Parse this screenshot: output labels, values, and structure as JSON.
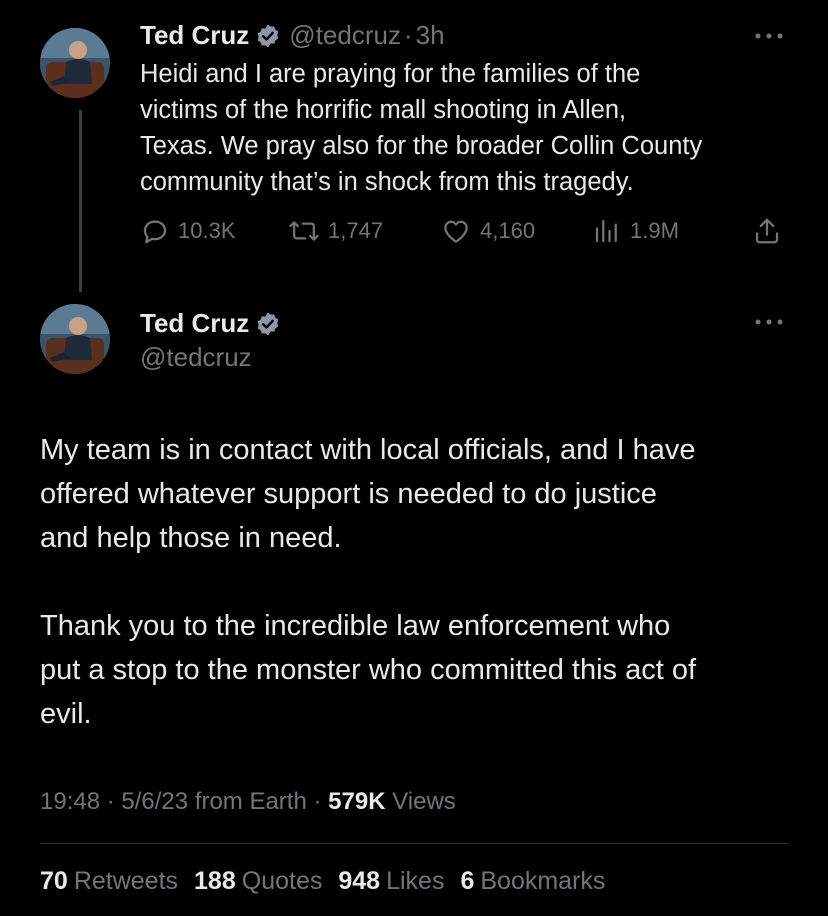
{
  "tweet1": {
    "author_name": "Ted Cruz",
    "handle": "@tedcruz",
    "separator": "·",
    "time": "3h",
    "text_lines": [
      "Heidi and I are praying for the families of the",
      "victims of the horrific  mall shooting in Allen,",
      "Texas. We pray also for the broader Collin County",
      "community that’s in shock from this tragedy."
    ],
    "replies": "10.3K",
    "retweets": "1,747",
    "likes": "4,160",
    "views": "1.9M"
  },
  "tweet2": {
    "author_name": "Ted Cruz",
    "handle": "@tedcruz",
    "paragraph1_lines": [
      "My team is in contact with local officials, and I have",
      "offered whatever support is needed to do justice",
      "and help those in need."
    ],
    "paragraph2_lines": [
      "Thank you to the incredible law enforcement who",
      "put a stop to the monster who committed this act of",
      "evil."
    ],
    "timestamp": "19:48 · 5/6/23 from Earth ·",
    "views_count": "579K",
    "views_label": "Views",
    "retweets_count": "70",
    "retweets_label": "Retweets",
    "quotes_count": "188",
    "quotes_label": "Quotes",
    "likes_count": "948",
    "likes_label": "Likes",
    "bookmarks_count": "6",
    "bookmarks_label": "Bookmarks"
  },
  "colors": {
    "background": "#000000",
    "text": "#e7e9ea",
    "muted": "#71767b",
    "verified": "#8b98a5"
  },
  "icons": [
    "reply-icon",
    "retweet-icon",
    "like-icon",
    "views-icon",
    "share-icon",
    "verified-badge-icon",
    "more-icon"
  ]
}
